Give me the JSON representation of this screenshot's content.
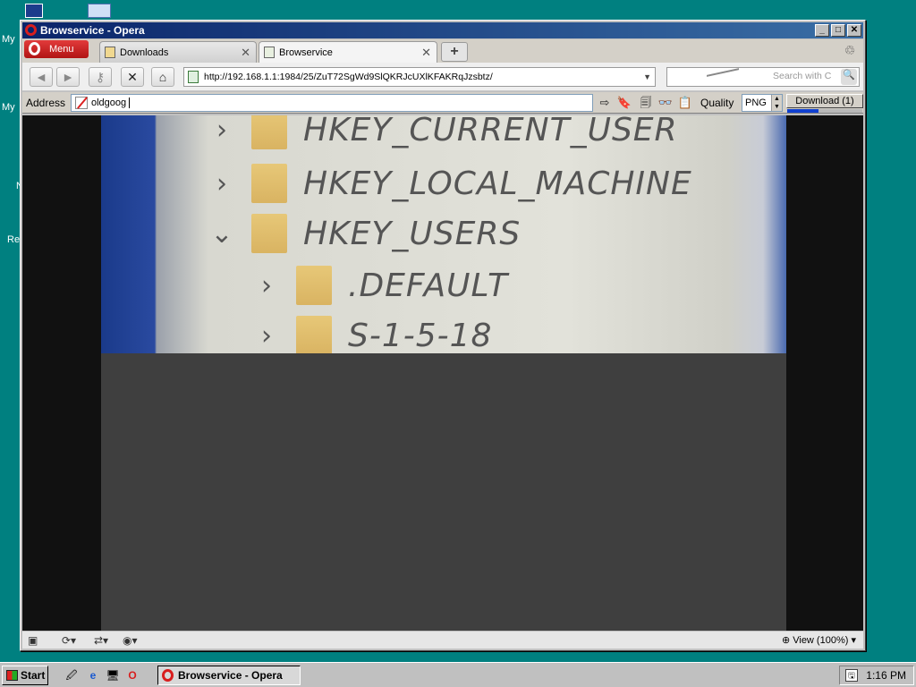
{
  "desktop": {
    "icon_labels": [
      "My",
      "My",
      "N",
      "Re"
    ]
  },
  "window": {
    "title": "Browservice - Opera",
    "controls": {
      "minimize": "_",
      "maximize": "□",
      "close": "✕"
    }
  },
  "tabs": {
    "menu_label": "Menu",
    "items": [
      {
        "label": "Downloads",
        "close": "✕"
      },
      {
        "label": "Browservice",
        "close": "✕"
      }
    ],
    "new_tab": "+"
  },
  "navbar": {
    "back": "◄",
    "forward": "►",
    "key": "⚷",
    "stop": "✕",
    "home": "⌂",
    "url": "http://192.168.1.1:1984/25/ZuT72SgWd9SlQKRJcUXlKFAKRqJzsbtz/",
    "url_dropdown": "▼",
    "search_placeholder": "Search with C",
    "search_button": "🔍"
  },
  "address_bar": {
    "label": "Address",
    "value": "oldgoog",
    "quality_label": "Quality",
    "quality_value": "PNG",
    "download_label": "Download (1)",
    "download_progress": 0.42,
    "tools": [
      "⇨",
      "🔖",
      "🗐",
      "👓",
      "📋"
    ]
  },
  "registry_tree": {
    "chevron_collapsed": "›",
    "chevron_expanded": "⌄",
    "items": [
      {
        "label": "HKEY_CURRENT_USER",
        "state": "collapsed"
      },
      {
        "label": "HKEY_LOCAL_MACHINE",
        "state": "collapsed"
      },
      {
        "label": "HKEY_USERS",
        "state": "expanded"
      },
      {
        "label": ".DEFAULT",
        "state": "collapsed"
      },
      {
        "label": "S-1-5-18",
        "state": "collapsed"
      }
    ]
  },
  "statusbar": {
    "panel_icon": "▣",
    "sync_icon": "⟳▾",
    "network_icon": "⇄▾",
    "turbo_icon": "◉▾",
    "zoom_label": "View (100%)",
    "zoom_icon": "⊕",
    "zoom_dropdown": "▾"
  },
  "taskbar": {
    "start_label": "Start",
    "quicklaunch": [
      "🖉",
      "e",
      "🖥",
      "O"
    ],
    "active_task": "Browservice - Opera",
    "time": "1:16 PM",
    "tray_icon": "🖫"
  },
  "colors": {
    "desktop": "#008080",
    "title_gradient_start": "#0a246a",
    "opera_red": "#d81e1e"
  }
}
